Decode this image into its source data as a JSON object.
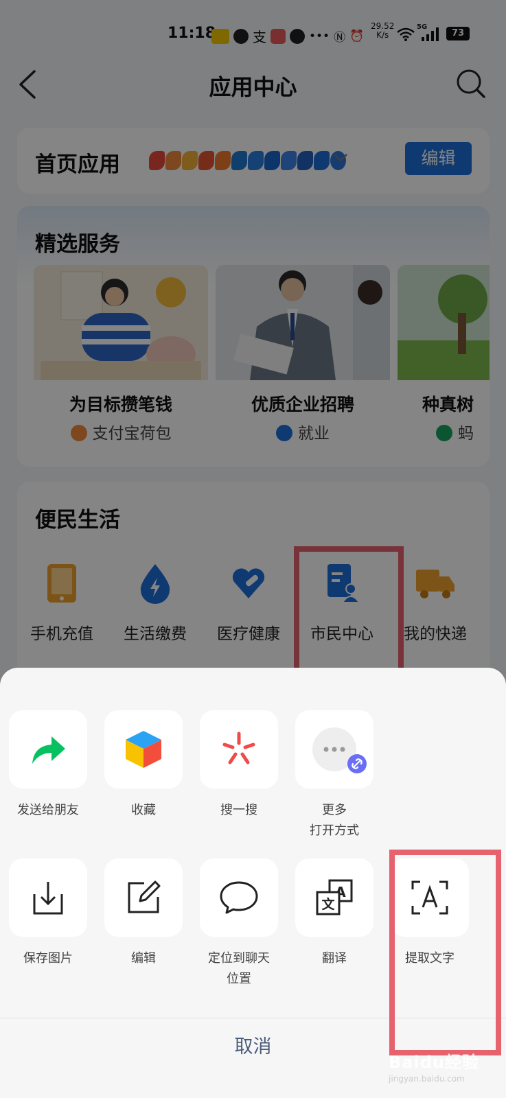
{
  "status_bar": {
    "time": "11:18",
    "network_speed": "29.52\nK/s",
    "signal_label": "5G",
    "battery": "73"
  },
  "header": {
    "title": "应用中心"
  },
  "home_apps": {
    "label": "首页应用",
    "edit_button": "编辑"
  },
  "featured": {
    "title": "精选服务",
    "cards": [
      {
        "name": "为目标攒笔钱",
        "source": "支付宝荷包"
      },
      {
        "name": "优质企业招聘",
        "source": "就业"
      },
      {
        "name": "种真树",
        "source": "蚂"
      }
    ]
  },
  "life": {
    "title": "便民生活",
    "items": [
      {
        "label": "手机充值"
      },
      {
        "label": "生活缴费"
      },
      {
        "label": "医疗健康"
      },
      {
        "label": "市民中心"
      },
      {
        "label": "我的快递"
      }
    ]
  },
  "sheet": {
    "row1": [
      {
        "label": "发送给朋友"
      },
      {
        "label": "收藏"
      },
      {
        "label": "搜一搜"
      },
      {
        "label": "更多\n打开方式"
      }
    ],
    "row2": [
      {
        "label": "保存图片"
      },
      {
        "label": "编辑"
      },
      {
        "label": "定位到聊天\n位置"
      },
      {
        "label": "翻译"
      },
      {
        "label": "提取文字"
      }
    ],
    "cancel": "取消"
  },
  "watermark": {
    "brand": "Baidu经验",
    "url": "jingyan.baidu.com"
  },
  "colors": {
    "highlight": "#e5626e",
    "primary_blue": "#1e6fd9",
    "wechat_green": "#07c160"
  }
}
